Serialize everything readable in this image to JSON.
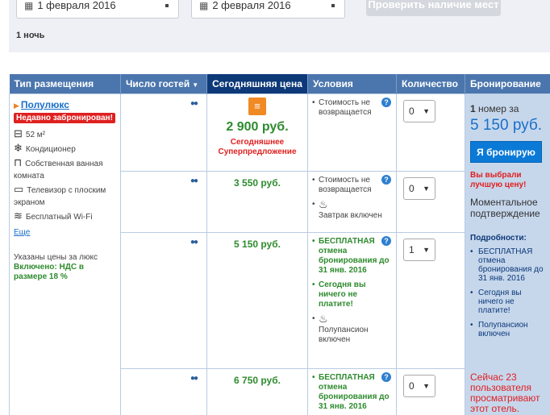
{
  "search": {
    "checkin": "1 февраля 2016",
    "checkout": "2 февраля 2016",
    "check_button": "Проверить наличие мест",
    "nights": "1 ночь"
  },
  "table": {
    "headers": {
      "type": "Тип размещения",
      "guests": "Число гостей",
      "today_price": "Сегодняшняя цена",
      "conditions": "Условия",
      "quantity": "Количество",
      "booking": "Бронирование"
    }
  },
  "room": {
    "name": "Полулюкс",
    "badge": "Недавно забронирован!",
    "amenities": [
      {
        "icon": "room-size-icon",
        "label": "52 м²"
      },
      {
        "icon": "air-conditioning-icon",
        "label": "Кондиционер"
      },
      {
        "icon": "bathroom-icon",
        "label": "Собственная ванная комната"
      },
      {
        "icon": "tv-icon",
        "label": "Телевизор с плоским экраном"
      },
      {
        "icon": "wifi-icon",
        "label": "Бесплатный Wi-Fi"
      }
    ],
    "more": "Еще",
    "price_note": "Указаны цены за люкс",
    "vat_note": "Включено: НДС в размере 18 %"
  },
  "offers": [
    {
      "price": "2 900 руб.",
      "deal_text": "Сегодняшнее Суперпредложение",
      "conditions": [
        {
          "text": "Стоимость не возвращается",
          "style": "normal"
        }
      ],
      "quantity": "0"
    },
    {
      "price": "3 550 руб.",
      "conditions": [
        {
          "text": "Стоимость не возвращается",
          "style": "normal"
        },
        {
          "text": "Завтрак включен",
          "style": "normal",
          "icon": "breakfast-icon"
        }
      ],
      "quantity": "0"
    },
    {
      "price": "5 150 руб.",
      "conditions": [
        {
          "text": "БЕСПЛАТНАЯ отмена бронирования до 31 янв. 2016",
          "style": "green"
        },
        {
          "text": "Сегодня вы ничего не платите!",
          "style": "green"
        },
        {
          "text": "Полупансион включен",
          "style": "normal",
          "icon": "half-board-icon"
        }
      ],
      "quantity": "1"
    },
    {
      "price": "6 750 руб.",
      "conditions": [
        {
          "text": "БЕСПЛАТНАЯ отмена бронирования до 31 янв. 2016",
          "style": "green"
        }
      ],
      "quantity": "0"
    }
  ],
  "booking": {
    "count_num": "1",
    "count_text": "номер за",
    "total": "5 150 руб.",
    "button": "Я бронирую",
    "chosen": "Вы выбрали лучшую цену!",
    "instant": "Моментальное подтверждение",
    "details_title": "Подробности:",
    "details": [
      "БЕСПЛАТНАЯ отмена бронирования до 31 янв. 2016",
      "Сегодня вы ничего не платите!",
      "Полупансион включен"
    ],
    "viewers": "Сейчас 23 пользователя просматривают этот отель."
  },
  "colors": {
    "header_bg": "#4b76ad",
    "today_header_bg": "#0d3978",
    "price_green": "#2e8b2e",
    "alert_red": "#e02020",
    "link_blue": "#1a6fc9",
    "book_button": "#0a7ad6",
    "booking_panel_bg": "#c6d7ec"
  }
}
